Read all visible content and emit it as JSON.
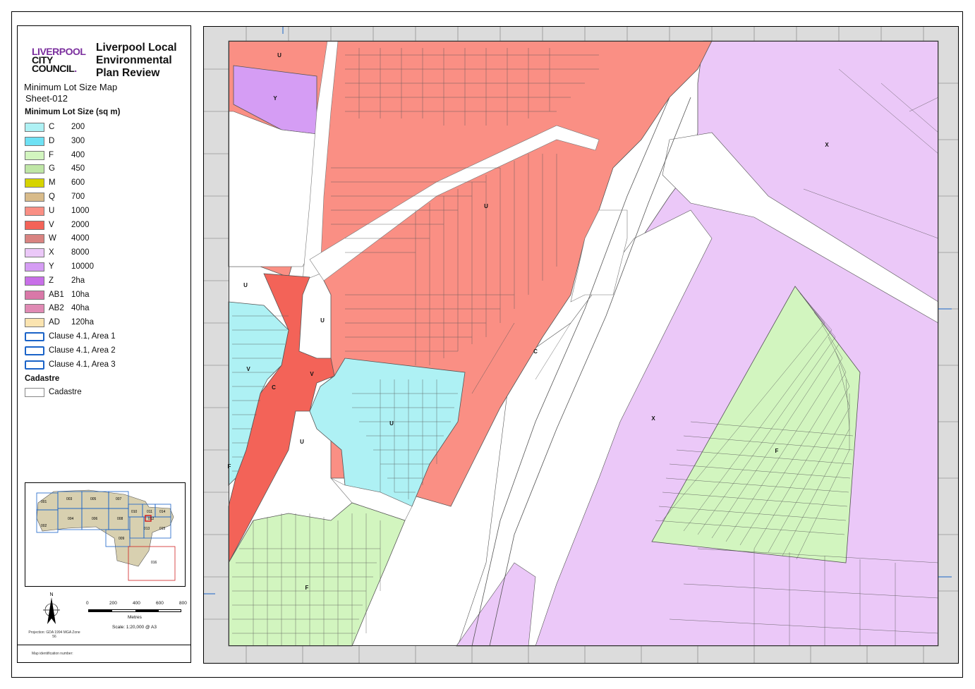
{
  "panel": {
    "logo_line1": "LIVERPOOL",
    "logo_line2": "CITY",
    "logo_line3": "COUNCIL",
    "title": "Liverpool Local Environmental Plan Review",
    "map_type": "Minimum Lot Size Map",
    "sheet": "Sheet-012",
    "legend_heading": "Minimum Lot Size (sq m)",
    "legend_items": [
      {
        "code": "C",
        "value": "200",
        "color": "#aef1f4"
      },
      {
        "code": "D",
        "value": "300",
        "color": "#6ee1f4"
      },
      {
        "code": "F",
        "value": "400",
        "color": "#d2f5bf"
      },
      {
        "code": "G",
        "value": "450",
        "color": "#bfe6a6"
      },
      {
        "code": "M",
        "value": "600",
        "color": "#d6d400"
      },
      {
        "code": "Q",
        "value": "700",
        "color": "#d8bb8a"
      },
      {
        "code": "U",
        "value": "1000",
        "color": "#fa8f84"
      },
      {
        "code": "V",
        "value": "2000",
        "color": "#f36358"
      },
      {
        "code": "W",
        "value": "4000",
        "color": "#d98381"
      },
      {
        "code": "X",
        "value": "8000",
        "color": "#ebc8f8"
      },
      {
        "code": "Y",
        "value": "10000",
        "color": "#d59df4"
      },
      {
        "code": "Z",
        "value": "2ha",
        "color": "#c86fe8"
      },
      {
        "code": "AB1",
        "value": "10ha",
        "color": "#d978a8"
      },
      {
        "code": "AB2",
        "value": "40ha",
        "color": "#e08ab4"
      },
      {
        "code": "AD",
        "value": "120ha",
        "color": "#fbe4b0"
      }
    ],
    "clause_items": [
      "Clause 4.1, Area 1",
      "Clause 4.1, Area 2",
      "Clause 4.1, Area 3"
    ],
    "cadastre_heading": "Cadastre",
    "cadastre_item": "Cadastre",
    "keymap_sheets": [
      "001",
      "002",
      "003",
      "004",
      "005",
      "006",
      "007",
      "008",
      "009",
      "010",
      "011",
      "012",
      "013",
      "014",
      "015",
      "016"
    ],
    "north_label": "N",
    "projection": "Projection: GDA 1994 MGA Zone 56",
    "scale_ticks": [
      "0",
      "200",
      "400",
      "600",
      "800"
    ],
    "scale_unit": "Metres",
    "scale_text": "Scale: 1:20,000 @ A3",
    "map_id": "Map identification number:"
  },
  "map": {
    "zone_labels": [
      "U",
      "Y",
      "X",
      "U",
      "U",
      "U",
      "C",
      "V",
      "V",
      "C",
      "U",
      "U",
      "X",
      "F",
      "F",
      "F"
    ]
  }
}
